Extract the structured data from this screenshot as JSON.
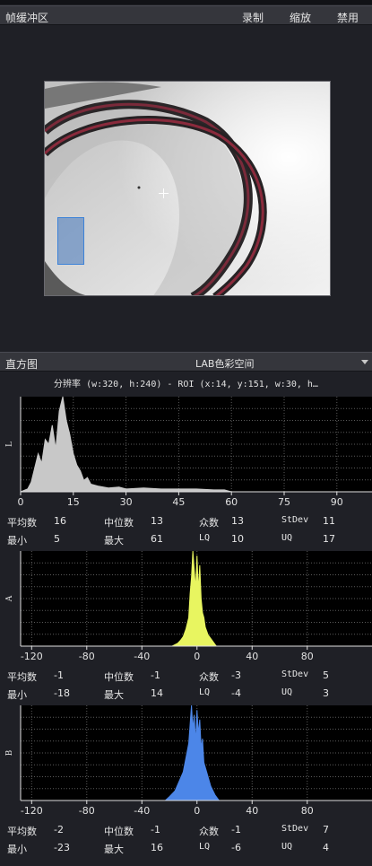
{
  "framebuffer": {
    "title": "帧缓冲区",
    "buttons": {
      "record": "录制",
      "zoom": "缩放",
      "disable": "禁用"
    }
  },
  "histogram": {
    "title": "直方图",
    "color_space": "LAB色彩空间",
    "resolution_line": "分辨率 (w:320, h:240) - ROI (x:14, y:151, w:30, h…"
  },
  "chart_data": [
    {
      "type": "area",
      "axis_letter": "L",
      "xlim": [
        0,
        100
      ],
      "x_ticks": [
        0,
        15,
        30,
        45,
        60,
        75,
        90
      ],
      "color": "#c8c8c8",
      "x": [
        0,
        2,
        3,
        4,
        5,
        6,
        7,
        8,
        9,
        10,
        11,
        12,
        13,
        14,
        15,
        16,
        17,
        18,
        19,
        20,
        22,
        25,
        28,
        30,
        35,
        40,
        45,
        50,
        55,
        58,
        60
      ],
      "y": [
        0,
        3,
        10,
        25,
        40,
        30,
        55,
        50,
        70,
        45,
        85,
        100,
        75,
        60,
        40,
        28,
        22,
        12,
        15,
        8,
        6,
        4,
        5,
        3,
        4,
        3,
        3,
        3,
        2,
        2,
        0
      ],
      "stats": {
        "mean": "16",
        "median": "13",
        "mode": "13",
        "stdev": "11",
        "min": "5",
        "max": "61",
        "lq": "10",
        "uq": "17"
      }
    },
    {
      "type": "area",
      "axis_letter": "A",
      "xlim": [
        -128,
        127
      ],
      "x_ticks": [
        -120,
        -80,
        -40,
        0,
        40,
        80
      ],
      "color": "#e8f560",
      "x": [
        -18,
        -14,
        -12,
        -10,
        -8,
        -6,
        -5,
        -4,
        -3,
        -2,
        -1,
        0,
        1,
        2,
        3,
        4,
        5,
        6,
        8,
        10,
        12,
        14
      ],
      "y": [
        0,
        3,
        6,
        10,
        18,
        30,
        55,
        72,
        100,
        80,
        60,
        95,
        58,
        85,
        50,
        35,
        30,
        20,
        12,
        8,
        4,
        0
      ],
      "stats": {
        "mean": "-1",
        "median": "-1",
        "mode": "-3",
        "stdev": "5",
        "min": "-18",
        "max": "14",
        "lq": "-4",
        "uq": "3"
      }
    },
    {
      "type": "area",
      "axis_letter": "B",
      "xlim": [
        -128,
        127
      ],
      "x_ticks": [
        -120,
        -80,
        -40,
        0,
        40,
        80
      ],
      "color": "#4c86e8",
      "x": [
        -23,
        -20,
        -16,
        -13,
        -10,
        -8,
        -6,
        -5,
        -4,
        -3,
        -2,
        -1,
        0,
        1,
        2,
        3,
        4,
        5,
        6,
        8,
        10,
        13,
        16
      ],
      "y": [
        0,
        4,
        10,
        20,
        30,
        45,
        60,
        80,
        100,
        75,
        90,
        60,
        95,
        70,
        85,
        55,
        65,
        40,
        35,
        25,
        15,
        6,
        0
      ],
      "stats": {
        "mean": "-2",
        "median": "-1",
        "mode": "-1",
        "stdev": "7",
        "min": "-23",
        "max": "16",
        "lq": "-6",
        "uq": "4"
      }
    }
  ],
  "stat_labels": {
    "mean": "平均数",
    "median": "中位数",
    "mode": "众数",
    "stdev": "StDev",
    "min": "最小",
    "max": "最大",
    "lq": "LQ",
    "uq": "UQ"
  }
}
